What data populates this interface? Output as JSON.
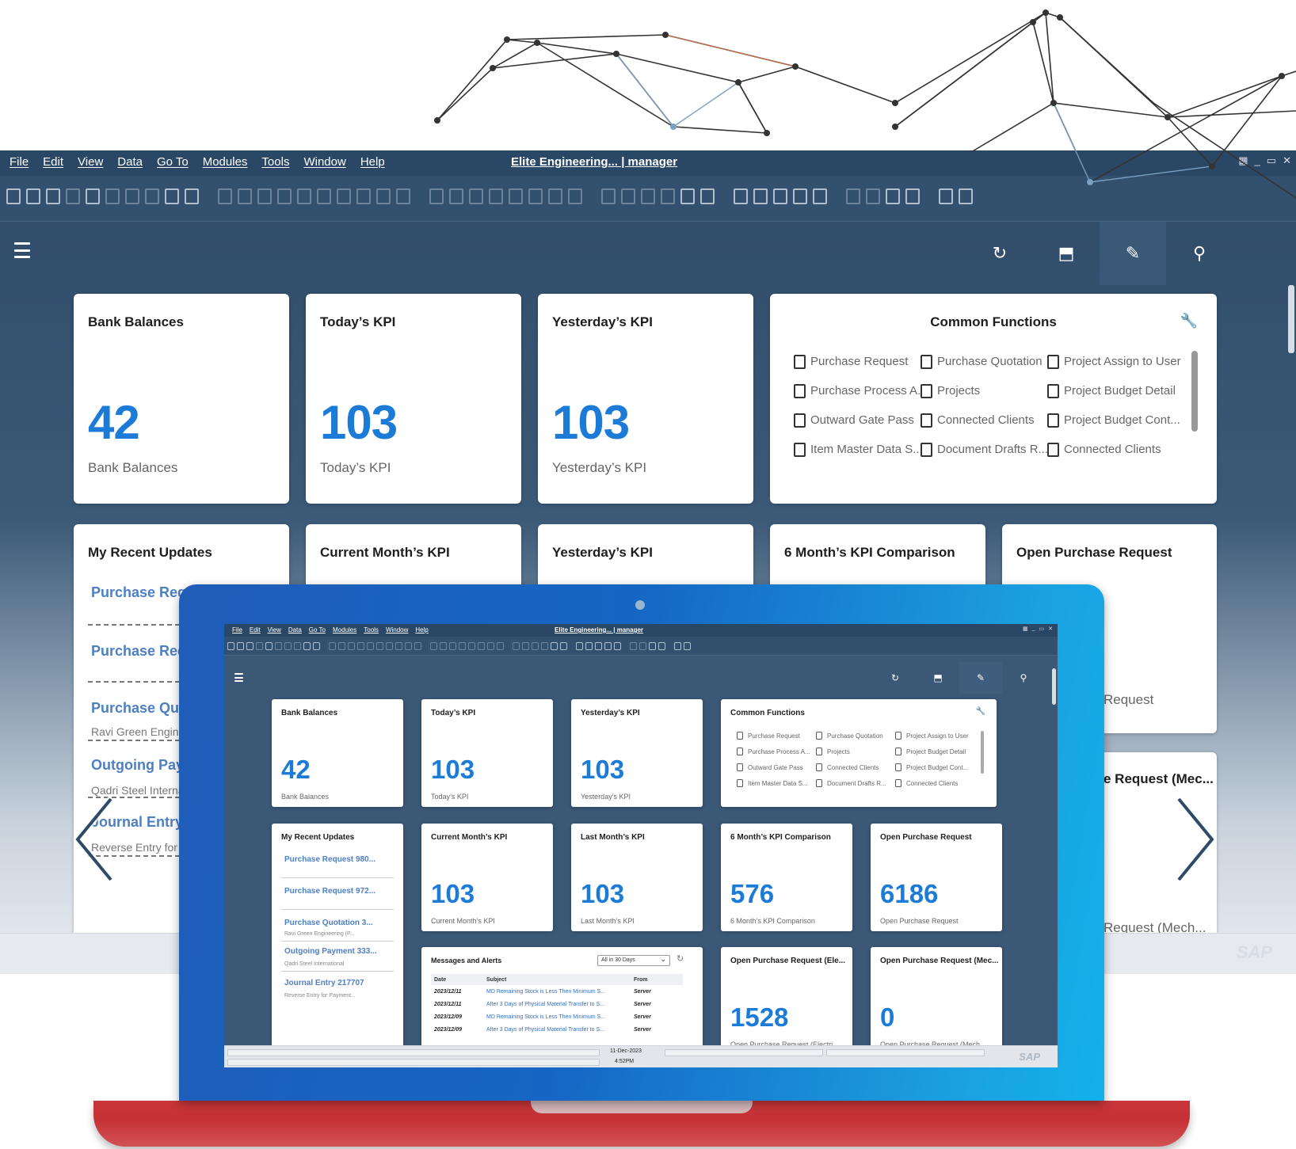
{
  "window": {
    "menus": [
      "File",
      "Edit",
      "View",
      "Data",
      "Go To",
      "Modules",
      "Tools",
      "Window",
      "Help"
    ],
    "title": "Elite Engineering... | manager"
  },
  "appbar_icons": [
    "refresh-icon",
    "cube-icon",
    "edit-pencil-icon",
    "search-icon"
  ],
  "colors": {
    "kpi_blue": "#1b7bd6",
    "link_blue": "#4d7fc3",
    "header_navy": "#2a4866",
    "laptop_red": "#c9363a",
    "laptop_blue": "#1566c4"
  },
  "tiles": {
    "bank_balances": {
      "title": "Bank Balances",
      "value": "42",
      "subtitle": "Bank Balances"
    },
    "todays_kpi": {
      "title": "Today’s KPI",
      "value": "103",
      "subtitle": "Today’s KPI"
    },
    "yesterdays_kpi": {
      "title": "Yesterday’s KPI",
      "value": "103",
      "subtitle": "Yesterday’s KPI"
    },
    "current_month_kpi": {
      "title": "Current Month’s KPI",
      "value": "103",
      "subtitle": "Current Month’s KPI"
    },
    "last_month_kpi": {
      "title": "Last Month’s KPI",
      "value": "103",
      "subtitle": "Last Month’s KPI"
    },
    "six_month_comparison": {
      "title": "6 Month’s KPI Comparison",
      "value": "576",
      "subtitle": "6 Month’s KPI Comparison"
    },
    "open_purchase_request": {
      "title": "Open Purchase Request",
      "value": "6186",
      "subtitle": "Open Purchase Request",
      "subtitle_partial": "Request"
    },
    "open_pr_elec": {
      "title": "Open Purchase Request (Ele...",
      "value": "1528",
      "subtitle": "Open Purchase Request (Electri..."
    },
    "open_pr_mech": {
      "title": "Open Purchase Request (Mec...",
      "title_partial": "e Request (Mec...",
      "value": "0",
      "subtitle": "Open Purchase Request (Mech...",
      "subtitle_partial": "Request (Mech..."
    }
  },
  "common_functions": {
    "title": "Common Functions",
    "items": [
      "Purchase Request",
      "Purchase Quotation",
      "Project Assign to User",
      "Purchase Process A...",
      "Projects",
      "Project Budget Detail",
      "Outward Gate Pass",
      "Connected Clients",
      "Project Budget Cont...",
      "Item Master Data S...",
      "Document Drafts R...",
      "Connected Clients"
    ]
  },
  "recent_updates": {
    "title": "My Recent Updates",
    "items": [
      {
        "link": "Purchase Request 980...",
        "sub": ""
      },
      {
        "link": "Purchase Request 972...",
        "sub": ""
      },
      {
        "link": "Purchase Quotation 3...",
        "sub": "Ravi Green Engineering (P..."
      },
      {
        "link": "Outgoing Payment 333...",
        "sub": "Qadri Steel International"
      },
      {
        "link": "Journal Entry 217707",
        "sub": "Reverse Entry for Payment..."
      }
    ],
    "bg_partial": [
      {
        "link": "Purchase Requ",
        "sub": ""
      },
      {
        "link": "Purchase Req",
        "sub": ""
      },
      {
        "link": "Purchase Quo",
        "sub": "Ravi Green Engine"
      },
      {
        "link": "Outgoing Pay",
        "sub": "Qadri Steel Internat"
      },
      {
        "link": "Journal Entry",
        "sub": "Reverse Entry for P"
      }
    ]
  },
  "messages_alerts": {
    "title": "Messages and Alerts",
    "filter": "All in 30 Days",
    "columns": [
      "Date",
      "Subject",
      "From"
    ],
    "rows": [
      {
        "date": "2023/12/11",
        "subject": "MD Remaining Stock is Less Then Minimum S...",
        "from": "Server"
      },
      {
        "date": "2023/12/11",
        "subject": "After 3 Days of Physical Material Transfer to S...",
        "from": "Server"
      },
      {
        "date": "2023/12/09",
        "subject": "MD Remaining Stock is Less Then Minimum S...",
        "from": "Server"
      },
      {
        "date": "2023/12/09",
        "subject": "After 3 Days of Physical Material Transfer to S...",
        "from": "Server"
      }
    ]
  },
  "status": {
    "date": "11-Dec-2023",
    "time": "4:52PM",
    "brand": "SAP"
  }
}
